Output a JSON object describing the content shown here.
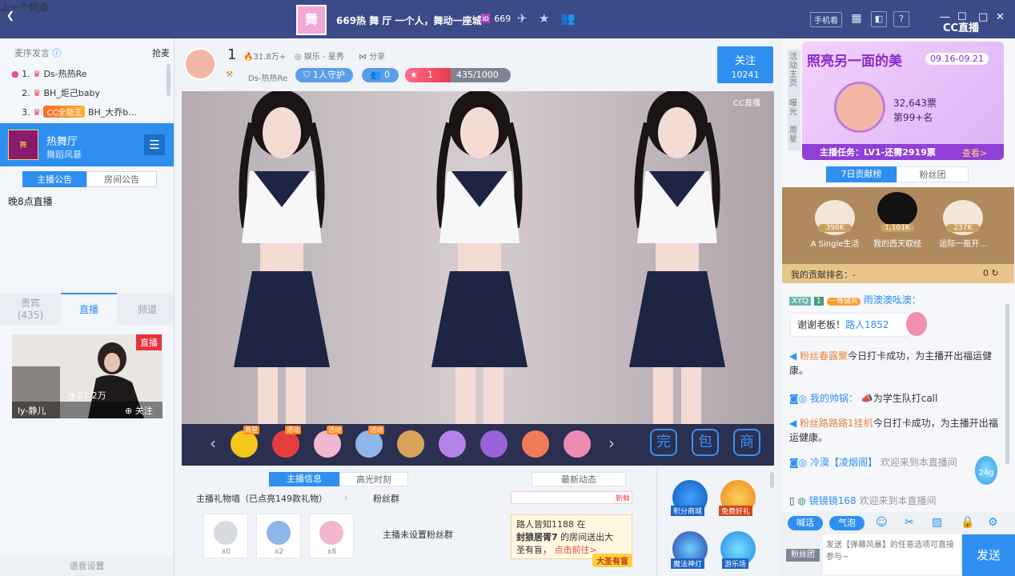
{
  "topbar": {
    "prev_channel": "上一个频道",
    "room_title": "669热 舞 厅 一个人，舞动一座城",
    "room_id": "669",
    "logo_text": "舞",
    "phone_watch": "手机看",
    "help": "?",
    "brand": "CC直播"
  },
  "left": {
    "guest_label": "麦序发言",
    "grab_label": "抢麦",
    "ranks": [
      {
        "num": "1.",
        "name": "Ds-热热Re"
      },
      {
        "num": "2.",
        "name": "BH_炬己baby"
      },
      {
        "num": "3.",
        "badge": "CC全能王",
        "name": "BH_大乔b..."
      }
    ],
    "channel_name": "热舞厅",
    "channel_sub": "舞蹈风暴",
    "tab_anchor_notice": "主播公告",
    "tab_room_notice": "房间公告",
    "notice_text": "晚8点直播",
    "tab_guests": "贵宾",
    "guest_count": "(435)",
    "tab_live": "直播",
    "tab_channel": "频道",
    "live_badge": "直播",
    "rec_views": "21.2万",
    "rec_name": "ly-静儿",
    "rec_follow": "关注",
    "voice_settings": "语音设置"
  },
  "center": {
    "rank_num": "1",
    "popularity": "31.8万+",
    "category": "娱乐 - 星秀",
    "share": "分享",
    "anchor_name": "Ds-热热Re",
    "guard": "1人守护",
    "fans": "0",
    "level": "1",
    "exp": "435/1000",
    "exp_progress": 0.435,
    "follow_label": "关注",
    "follow_count": "10241",
    "video_watermark": "CC直播",
    "tab_info": "主播信息",
    "tab_highlight": "高光时刻",
    "tab_news": "最新动态",
    "gift_wall": "主播礼物墙（已点亮149款礼物）",
    "fan_group": "粉丝群",
    "fan_group_empty": "主播未设置粉丝群",
    "gift_counts": [
      "x0",
      "x2",
      "x8"
    ],
    "gift_tags": [
      "周星",
      "活动",
      "活动",
      "活动"
    ],
    "news_hot": "新鲜",
    "news_line1": "路人皆知1188 在",
    "news_line2": "封狼居胥7",
    "news_line2b": "的房间送出大",
    "news_line3": "圣有盲，",
    "news_link": "点击前往>",
    "news_btn": "大圣有盲",
    "act_mall": "积分商城",
    "act_free": "免费好礼",
    "act_lantern": "魔法神灯",
    "act_park": "游乐场",
    "big_icons": [
      "完",
      "包",
      "商"
    ]
  },
  "right": {
    "side_tabs": [
      "活动主页",
      "曝光",
      "周星"
    ],
    "event_title": "照亮另一面的美",
    "event_date": "09.16-09.21",
    "event_votes": "32,643票",
    "event_rank": "第99+名",
    "event_task": "主播任务：LV1-还需2919票",
    "event_view": "查看>",
    "tab_week": "7日贡献榜",
    "tab_fans": "粉丝团",
    "top3": [
      {
        "score": "398K",
        "name": "A Single生活"
      },
      {
        "score": "1,101K",
        "name": "我的西天取经"
      },
      {
        "score": "237K",
        "name": "运际一瓶开..."
      }
    ],
    "my_rank_label": "我的贡献排名：",
    "my_rank_value": "-",
    "my_rank_score": "0",
    "chat": [
      {
        "tag": "XYQ",
        "lv": "1",
        "badge": "一等骑兵",
        "user": "雨澳澳吆澳：",
        "msg": ""
      },
      {
        "bubble": "谢谢老板！",
        "bubble_user": "路人1852"
      },
      {
        "user": "粉丝春露聚",
        "msg": "今日打卡成功，为主播开出福运健康。"
      },
      {
        "user": "我的帅锅：",
        "msg": "为学生队打call"
      },
      {
        "user": "粉丝路路路1挂机",
        "msg": "今日打卡成功，为主播开出福运健康。"
      },
      {
        "user": "冷漠【凌烟阁】",
        "msg": "欢迎来到本直播间"
      },
      {
        "user": "镜镜镜168",
        "msg": "欢迎来到本直播间"
      }
    ],
    "countdown": "24g",
    "btn_shout": "喊话",
    "btn_bubble": "气泡",
    "fan_group_btn": "粉丝团",
    "input_placeholder": "发送【弹幕风暴】的任意选项可直接参与~",
    "send": "发送"
  }
}
